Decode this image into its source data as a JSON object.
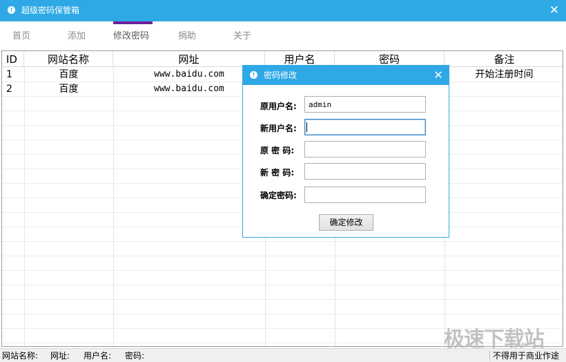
{
  "window": {
    "title": "超级密码保管箱",
    "close_glyph": "✕",
    "icon_glyph": "!"
  },
  "menu": {
    "items": [
      {
        "label": "首页"
      },
      {
        "label": "添加"
      },
      {
        "label": "修改密码"
      },
      {
        "label": "捐助"
      },
      {
        "label": "关于"
      }
    ],
    "active": "修改密码"
  },
  "table": {
    "columns": [
      "ID",
      "网站名称",
      "网址",
      "用户名",
      "密码",
      "备注"
    ],
    "rows": [
      {
        "id": "1",
        "name": "百度",
        "url": "www.baidu.com",
        "user": "",
        "password": "",
        "note": "开始注册时间"
      },
      {
        "id": "2",
        "name": "百度",
        "url": "www.baidu.com",
        "user": "",
        "password": "",
        "note": ""
      }
    ]
  },
  "dialog": {
    "title": "密码修改",
    "close_glyph": "✕",
    "icon_glyph": "!",
    "fields": [
      {
        "label": "原用户名:",
        "value": "admin"
      },
      {
        "label": "新用户名:",
        "value": ""
      },
      {
        "label": "原 密 码:",
        "value": ""
      },
      {
        "label": "新 密 码:",
        "value": ""
      },
      {
        "label": "确定密码:",
        "value": ""
      }
    ],
    "confirm_label": "确定修改"
  },
  "status": {
    "site_label": "网站名称:",
    "url_label": "网址:",
    "user_label": "用户名:",
    "password_label": "密码:",
    "notice": "不得用于商业作途"
  },
  "watermark": {
    "text": "极速下载站"
  },
  "colors": {
    "accent": "#2fa9e6",
    "tab_indicator": "#6f1f9e"
  }
}
